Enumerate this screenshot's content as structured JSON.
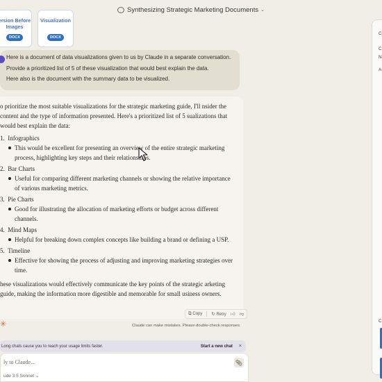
{
  "topbar": {
    "title": "Synthesizing Strategic Marketing Documents"
  },
  "attachments": [
    {
      "title_line1": "ersion Before",
      "title_line2": "Images",
      "badge": "DOCX"
    },
    {
      "title_line1": "Visualization",
      "badge": "DOCX"
    }
  ],
  "user_message": {
    "lines": [
      "Here is a document of data visualizations given to us by Claude in a separate conversation.",
      "Provide a prioritized list of 5 of these visualization that would best explain the data.",
      "Here also is the document with the summary data to be visualized."
    ]
  },
  "reply": {
    "intro": "o prioritize the most suitable visualizations for the strategic marketing guide, I'll nsider the content and the type of information presented. Here's a prioritized list of 5 sualizations that would best explain the data:",
    "items": [
      {
        "num": "1.",
        "title": "Infographics",
        "bullet": "This would be excellent for presenting an overview of the entire strategic marketing process, highlighting key steps and their relationships."
      },
      {
        "num": "2.",
        "title": "Bar Charts",
        "bullet": "Useful for comparing different marketing channels or showing the relative importance of various marketing metrics."
      },
      {
        "num": "3.",
        "title": "Pie Charts",
        "bullet": "Good for illustrating the allocation of marketing efforts or budget across different channels."
      },
      {
        "num": "4.",
        "title": "Mind Maps",
        "bullet": "Helpful for breaking down complex concepts like building a brand or defining a USP."
      },
      {
        "num": "5.",
        "title": "Timeline",
        "bullet": "Effective for showing the process of adjusting and improving marketing strategies over time."
      }
    ],
    "closing": "hese visualizations would effectively communicate the key points of the strategic arketing guide, making the information more digestible and memorable for small usiness owners."
  },
  "actions": {
    "copy": "Copy",
    "retry": "Retry"
  },
  "disclaimer": "Claude can make mistakes. Please double-check responses.",
  "usage_banner": {
    "text": "Long chats cause you to reach your usage limits faster.",
    "action": "Start a new chat",
    "close": "×"
  },
  "composer": {
    "placeholder": "ly to Claude...",
    "model": "ude 3.5 Sonnet"
  },
  "right_panel": {
    "letters": [
      "C",
      "C",
      "N",
      "A",
      "C"
    ]
  },
  "colors": {
    "accent_purple": "#5a4cc2",
    "docx_blue": "#2d6ec8",
    "spark_orange": "#d9652f"
  }
}
